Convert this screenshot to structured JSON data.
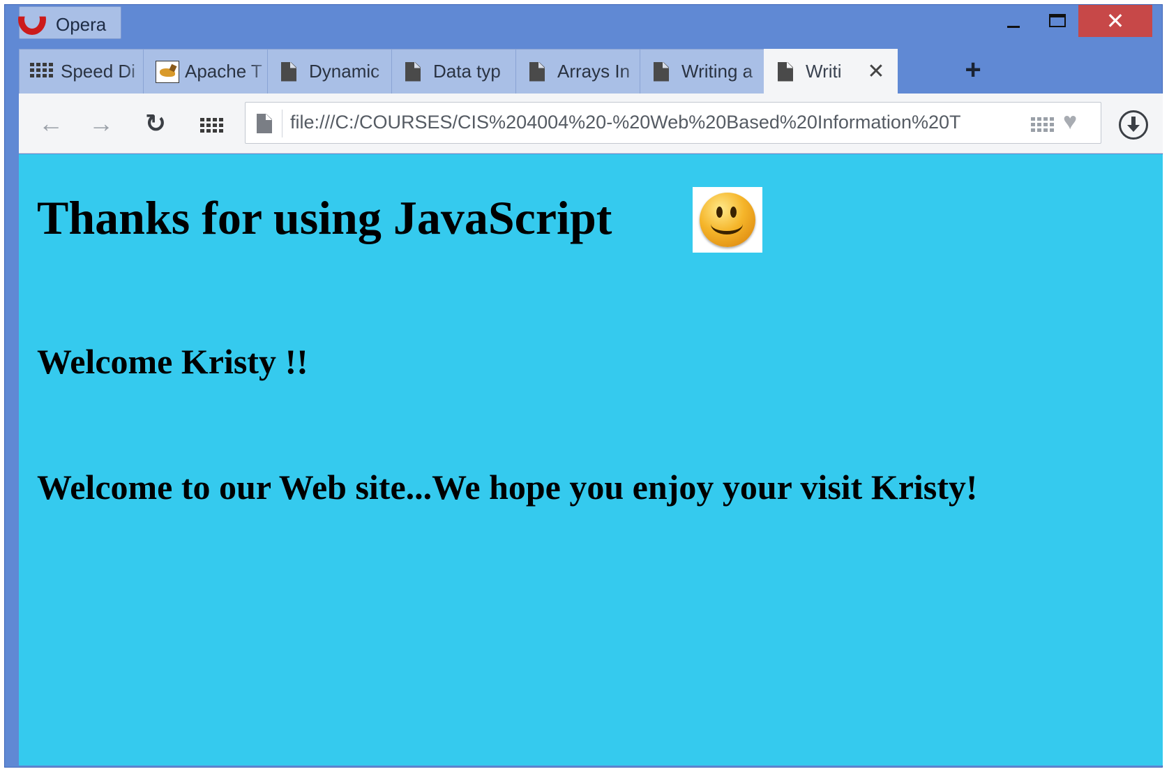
{
  "window": {
    "app_name": "Opera",
    "controls": {
      "minimize": "minimize-icon",
      "maximize": "maximize-icon",
      "close": "close-icon"
    },
    "close_glyph": "✕"
  },
  "tabs": [
    {
      "label": "Speed Di",
      "icon": "speed-dial-icon",
      "active": false
    },
    {
      "label": "Apache T",
      "icon": "tomcat-icon",
      "active": false
    },
    {
      "label": "Dynamic",
      "icon": "page-icon",
      "active": false
    },
    {
      "label": "Data typ",
      "icon": "page-icon",
      "active": false
    },
    {
      "label": "Arrays In",
      "icon": "page-icon",
      "active": false
    },
    {
      "label": "Writing a",
      "icon": "page-icon",
      "active": false
    },
    {
      "label": "Writi",
      "icon": "page-icon",
      "active": true,
      "close_glyph": "✕"
    }
  ],
  "new_tab_glyph": "+",
  "navigation": {
    "back_glyph": "←",
    "forward_glyph": "→",
    "reload_glyph": "↻",
    "address": "file:///C:/COURSES/CIS%204004%20-%20Web%20Based%20Information%20T",
    "heart_glyph": "♥"
  },
  "page": {
    "background": "#35caee",
    "heading": "Thanks for using JavaScript",
    "greeting": "Welcome Kristy !!",
    "message": "Welcome to our Web site...We hope you enjoy your visit Kristy!",
    "image": "smiley-face-icon"
  }
}
